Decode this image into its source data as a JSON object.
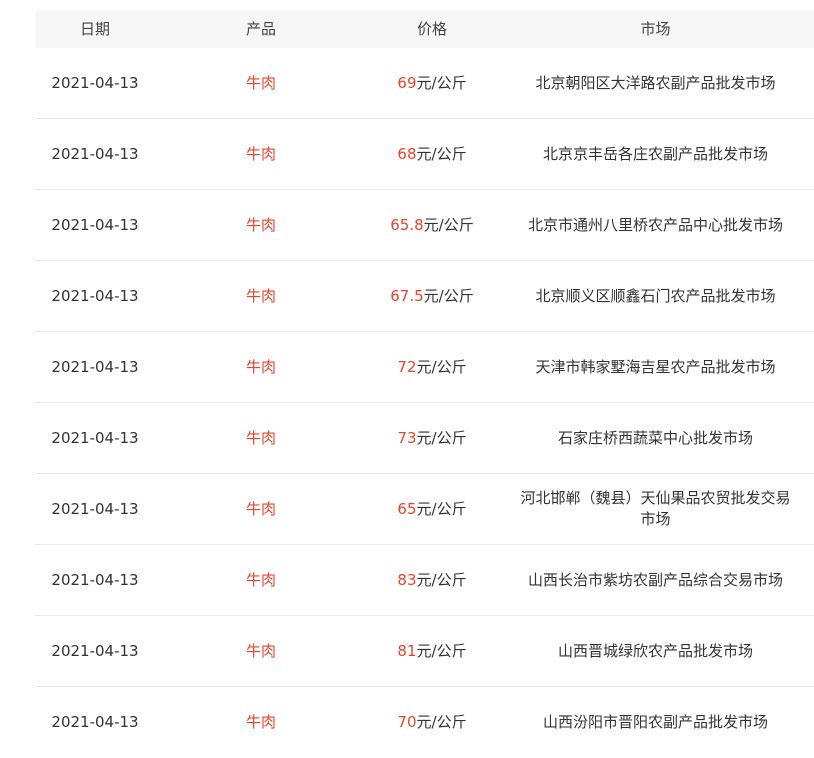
{
  "headers": {
    "date": "日期",
    "product": "产品",
    "price": "价格",
    "market": "市场"
  },
  "colors": {
    "accent": "#e8452c",
    "header_bg": "#f6f6f6",
    "divider": "#e8e8e8"
  },
  "rows": [
    {
      "date": "2021-04-13",
      "product": "牛肉",
      "price_value": "69",
      "price_unit": "元/公斤",
      "market": "北京朝阳区大洋路农副产品批发市场"
    },
    {
      "date": "2021-04-13",
      "product": "牛肉",
      "price_value": "68",
      "price_unit": "元/公斤",
      "market": "北京京丰岳各庄农副产品批发市场"
    },
    {
      "date": "2021-04-13",
      "product": "牛肉",
      "price_value": "65.8",
      "price_unit": "元/公斤",
      "market": "北京市通州八里桥农产品中心批发市场"
    },
    {
      "date": "2021-04-13",
      "product": "牛肉",
      "price_value": "67.5",
      "price_unit": "元/公斤",
      "market": "北京顺义区顺鑫石门农产品批发市场"
    },
    {
      "date": "2021-04-13",
      "product": "牛肉",
      "price_value": "72",
      "price_unit": "元/公斤",
      "market": "天津市韩家墅海吉星农产品批发市场"
    },
    {
      "date": "2021-04-13",
      "product": "牛肉",
      "price_value": "73",
      "price_unit": "元/公斤",
      "market": "石家庄桥西蔬菜中心批发市场"
    },
    {
      "date": "2021-04-13",
      "product": "牛肉",
      "price_value": "65",
      "price_unit": "元/公斤",
      "market": "河北邯郸（魏县）天仙果品农贸批发交易市场"
    },
    {
      "date": "2021-04-13",
      "product": "牛肉",
      "price_value": "83",
      "price_unit": "元/公斤",
      "market": "山西长治市紫坊农副产品综合交易市场"
    },
    {
      "date": "2021-04-13",
      "product": "牛肉",
      "price_value": "81",
      "price_unit": "元/公斤",
      "market": "山西晋城绿欣农产品批发市场"
    },
    {
      "date": "2021-04-13",
      "product": "牛肉",
      "price_value": "70",
      "price_unit": "元/公斤",
      "market": "山西汾阳市晋阳农副产品批发市场"
    }
  ]
}
